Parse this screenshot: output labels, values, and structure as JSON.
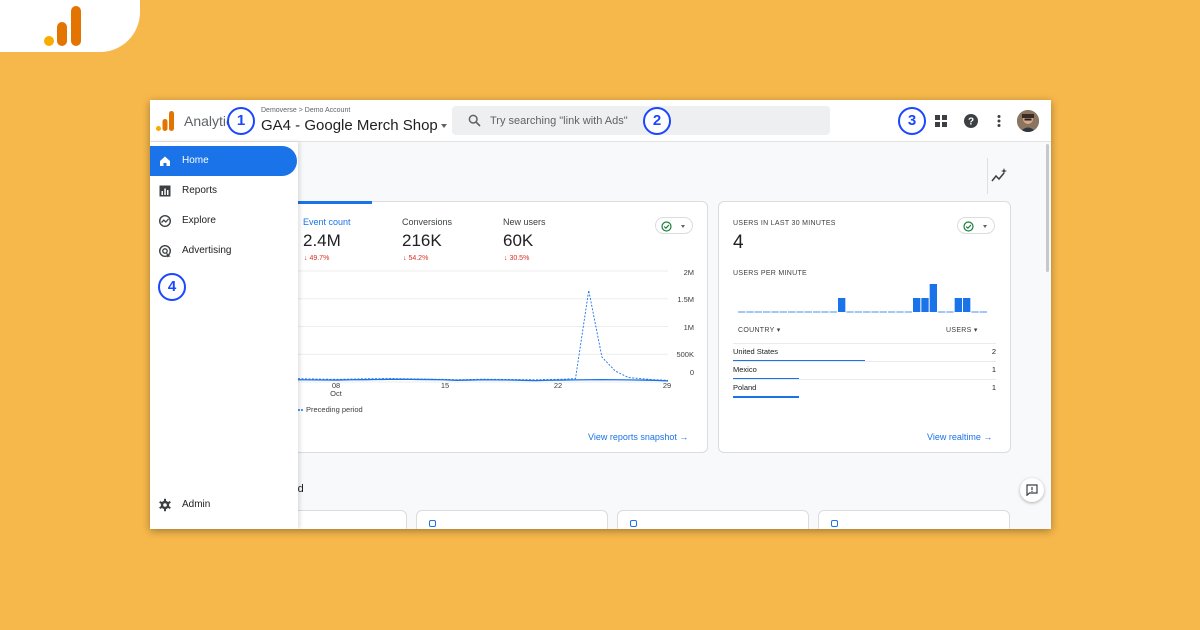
{
  "app": {
    "title": "Analytics",
    "breadcrumb": "Demoverse > Demo Account",
    "property": "GA4 - Google Merch Shop"
  },
  "search": {
    "placeholder": "Try searching \"link with Ads\""
  },
  "callouts": [
    "1",
    "2",
    "3",
    "4"
  ],
  "sidebar": {
    "items": [
      {
        "label": "Home",
        "icon": "home-icon",
        "active": true
      },
      {
        "label": "Reports",
        "icon": "bar-chart-icon",
        "active": false
      },
      {
        "label": "Explore",
        "icon": "explore-icon",
        "active": false
      },
      {
        "label": "Advertising",
        "icon": "advertising-icon",
        "active": false
      }
    ],
    "admin_label": "Admin"
  },
  "overview": {
    "metrics": [
      {
        "label": "Event count",
        "value": "2.4M",
        "change": "↓ 49.7%"
      },
      {
        "label": "Conversions",
        "value": "216K",
        "change": "↓ 54.2%"
      },
      {
        "label": "New users",
        "value": "60K",
        "change": "↓ 30.5%"
      }
    ],
    "legend_label": "Preceding period",
    "link": "View reports snapshot"
  },
  "chart_data": {
    "type": "line",
    "x": [
      1,
      2,
      3,
      4,
      5,
      6,
      7,
      8,
      9,
      10,
      11,
      12,
      13,
      14,
      15,
      16,
      17,
      18,
      19,
      20,
      21,
      22,
      23,
      24,
      25,
      26,
      27,
      28,
      29
    ],
    "x_tick_labels": [
      {
        "x": 8,
        "label": "08"
      },
      {
        "x": 8,
        "label": "Oct"
      },
      {
        "x": 15,
        "label": "15"
      },
      {
        "x": 22,
        "label": "22"
      },
      {
        "x": 29,
        "label": "29"
      }
    ],
    "y_tick_labels": [
      "2M",
      "1.5M",
      "1M",
      "500K",
      "0"
    ],
    "ylim": [
      0,
      2000000
    ],
    "series": [
      {
        "values": [
          40000,
          38000,
          36000,
          35000,
          40000,
          42000,
          45000,
          48000,
          50000,
          46000,
          44000,
          40000,
          30000,
          35000,
          40000,
          38000,
          36000,
          30000,
          25000,
          32000,
          35000,
          38000,
          40000,
          42000,
          40000,
          38000,
          35000,
          30000,
          20000
        ],
        "color": "#1a73e8",
        "style": "solid"
      },
      {
        "name": "Preceding period",
        "values": [
          60000,
          55000,
          50000,
          48000,
          52000,
          58000,
          60000,
          62000,
          58000,
          55000,
          50000,
          48000,
          40000,
          45000,
          50000,
          48000,
          46000,
          42000,
          40000,
          45000,
          50000,
          60000,
          1650000,
          450000,
          200000,
          80000,
          60000,
          40000,
          30000
        ],
        "color": "#1a73e8",
        "style": "dashed"
      }
    ]
  },
  "realtime": {
    "heading": "USERS IN LAST 30 MINUTES",
    "value": "4",
    "per_minute_label": "USERS PER MINUTE",
    "per_minute_values": [
      0,
      0,
      0,
      0,
      0,
      0,
      0,
      0,
      0,
      0,
      0,
      0,
      1,
      0,
      0,
      0,
      0,
      0,
      0,
      0,
      0,
      1,
      1,
      2,
      0,
      0,
      1,
      1,
      0,
      0
    ],
    "country_header": "COUNTRY",
    "users_header": "USERS",
    "rows": [
      {
        "country": "United States",
        "users": "2",
        "share": 1.0
      },
      {
        "country": "Mexico",
        "users": "1",
        "share": 0.5
      },
      {
        "country": "Poland",
        "users": "1",
        "share": 0.5
      }
    ],
    "link": "View realtime"
  },
  "section2_title_fragment": "sed"
}
